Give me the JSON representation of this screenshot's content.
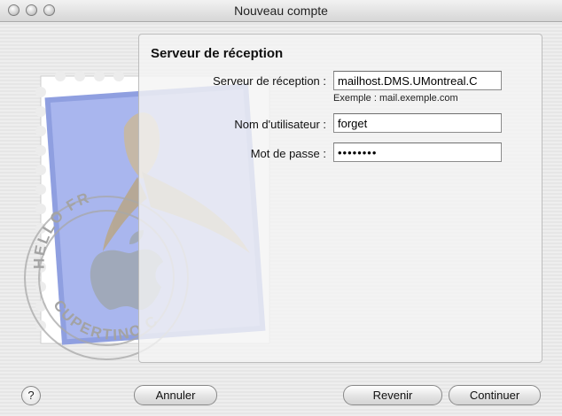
{
  "window": {
    "title": "Nouveau compte"
  },
  "stamp": {
    "text_top": "HELLO FR",
    "text_bottom": "CUPERTINO CA"
  },
  "form": {
    "section_title": "Serveur de réception",
    "server_label": "Serveur de réception :",
    "server_value": "mailhost.DMS.UMontreal.C",
    "server_hint": "Exemple : mail.exemple.com",
    "username_label": "Nom d'utilisateur :",
    "username_value": "forget",
    "password_label": "Mot de passe :",
    "password_value": "••••••••"
  },
  "buttons": {
    "help_label": "?",
    "cancel_label": "Annuler",
    "back_label": "Revenir",
    "continue_label": "Continuer"
  }
}
